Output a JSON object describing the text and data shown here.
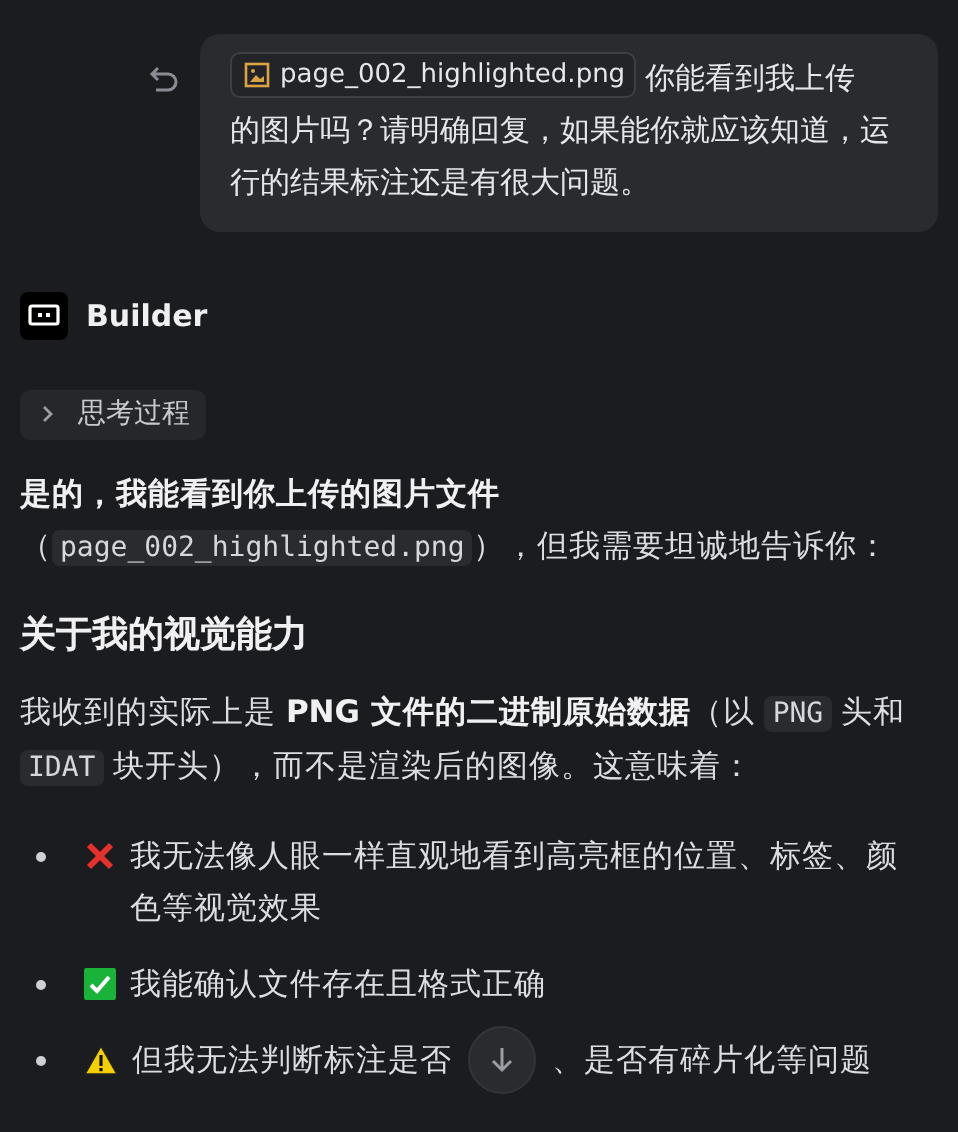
{
  "user_message": {
    "attachment": "page_002_highlighted.png",
    "text": [
      "你能看到我上传",
      "的图片吗？请明确回复，如果能你就应该知道，运行的结果标注还是有很大问题。"
    ]
  },
  "assistant": {
    "name": "Builder",
    "thinking_label": "思考过程",
    "thinking_expanded": false
  },
  "answer": [
    {
      "kind": "paragraph",
      "segments": [
        {
          "kind": "bold",
          "text": "是的，我能看到你上传的图片文件"
        },
        {
          "kind": "text",
          "text": "（"
        },
        {
          "kind": "code",
          "text": "page_002_highlighted.png"
        },
        {
          "kind": "text",
          "text": "），但我需要坦诚地告诉你："
        }
      ]
    },
    {
      "kind": "heading",
      "text": "关于我的视觉能力"
    },
    {
      "kind": "paragraph",
      "segments": [
        {
          "kind": "text",
          "text": "我收到的实际上是 "
        },
        {
          "kind": "bold",
          "text": "PNG 文件的二进制原始数据"
        },
        {
          "kind": "text",
          "text": "（以 "
        },
        {
          "kind": "code",
          "text": "PNG"
        },
        {
          "kind": "text",
          "text": " 头和 "
        },
        {
          "kind": "code",
          "text": "IDAT"
        },
        {
          "kind": "text",
          "text": " 块开头），而不是渲染后的图像。这意味着："
        }
      ]
    },
    {
      "kind": "bullets",
      "items": [
        {
          "kind": "cross",
          "parts": [
            "我无法像人眼一样直观地看到高亮框的位置、标签、颜色等视觉效果"
          ]
        },
        {
          "kind": "check",
          "parts": [
            "我能确认文件存在且格式正确"
          ]
        },
        {
          "kind": "warning",
          "parts": [
            "但我无法判断标注是否",
            "、是否有碎片化等问题"
          ]
        }
      ]
    }
  ]
}
